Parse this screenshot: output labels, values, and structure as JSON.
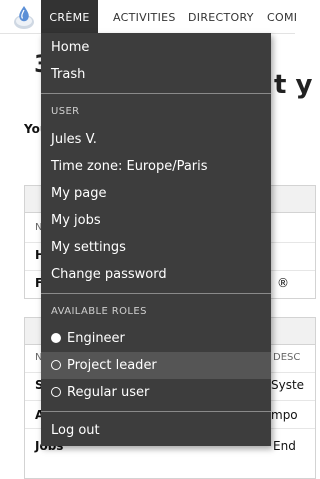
{
  "nav": {
    "items": [
      "CRÈME",
      "ACTIVITIES",
      "DIRECTORY",
      "COMI"
    ],
    "active": "CRÈME"
  },
  "background": {
    "t_fragment": "t y",
    "you_fragment": "You",
    "box1": {
      "row_n": "N",
      "row_h": "H",
      "row_f": "F",
      "mark": "®"
    },
    "box2": {
      "col_n": "N",
      "col_desc": "DESC",
      "row1_a": "S",
      "row1_b": "Syste",
      "row2_a": "A",
      "row2_b": "mpo",
      "row3_a": "Jobs",
      "row3_b": "End"
    }
  },
  "menu": {
    "home": "Home",
    "trash": "Trash",
    "user_section": "USER",
    "user_name": "Jules V.",
    "timezone": "Time zone: Europe/Paris",
    "my_page": "My page",
    "my_jobs": "My jobs",
    "my_settings": "My settings",
    "change_password": "Change password",
    "roles_section": "AVAILABLE ROLES",
    "roles": [
      {
        "label": "Engineer",
        "selected": true
      },
      {
        "label": "Project leader",
        "selected": false
      },
      {
        "label": "Regular user",
        "selected": false
      }
    ],
    "logout": "Log out"
  },
  "colors": {
    "menu_bg": "#3d3d3d",
    "menu_hover": "#555555",
    "nav_active": "#333333"
  }
}
